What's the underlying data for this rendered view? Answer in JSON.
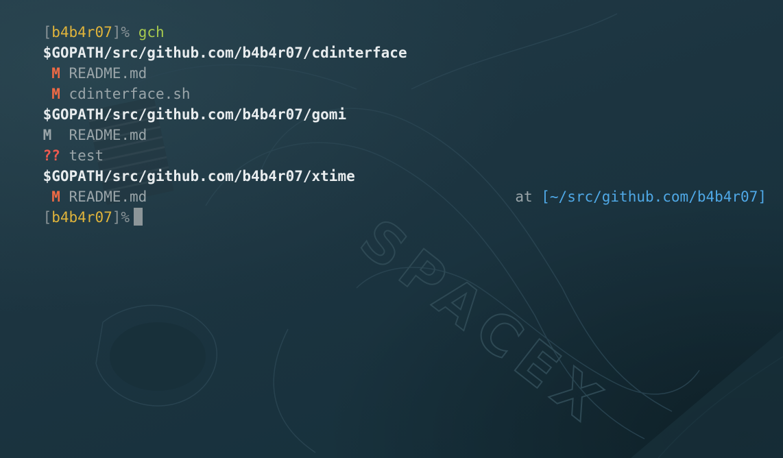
{
  "prompt": {
    "open_bracket": "[",
    "user": "b4b4r07",
    "close_bracket": "]",
    "symbol": "%"
  },
  "command": "gch",
  "output": [
    {
      "type": "path",
      "text": "$GOPATH/src/github.com/b4b4r07/cdinterface"
    },
    {
      "type": "file",
      "status": " M",
      "status_kind": "modified",
      "name": "README.md"
    },
    {
      "type": "file",
      "status": " M",
      "status_kind": "modified",
      "name": "cdinterface.sh"
    },
    {
      "type": "path",
      "text": "$GOPATH/src/github.com/b4b4r07/gomi"
    },
    {
      "type": "file",
      "status": "M ",
      "status_kind": "staged",
      "name": "README.md"
    },
    {
      "type": "file",
      "status": "??",
      "status_kind": "untracked",
      "name": "test"
    },
    {
      "type": "path",
      "text": "$GOPATH/src/github.com/b4b4r07/xtime"
    },
    {
      "type": "file",
      "status": " M",
      "status_kind": "modified",
      "name": "README.md"
    }
  ],
  "right_prompt": {
    "at_label": "at",
    "directory": "[~/src/github.com/b4b4r07]"
  },
  "background": {
    "watermark_text": "SPACEX"
  },
  "colors": {
    "background": "#1d3440",
    "user": "#e0b43b",
    "command": "#a7c94e",
    "modified": "#ee6a45",
    "untracked": "#ee5a50",
    "directory": "#4fa8e6"
  }
}
